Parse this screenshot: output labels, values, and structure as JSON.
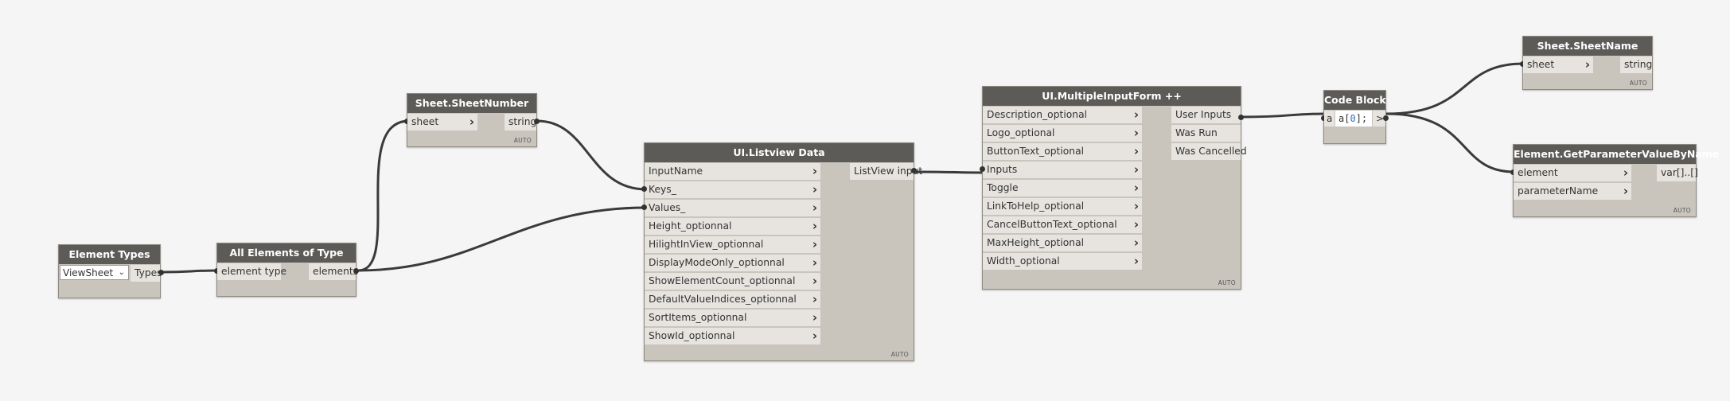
{
  "nodes": {
    "element_types": {
      "title": "Element Types",
      "dropdown_value": "ViewSheet",
      "output": "Types"
    },
    "all_elements": {
      "title": "All Elements of Type",
      "input": "element type",
      "output": "elements"
    },
    "sheet_number": {
      "title": "Sheet.SheetNumber",
      "input": "sheet",
      "output": "string",
      "badge": "AUTO"
    },
    "listview": {
      "title": "UI.Listview Data",
      "inputs": [
        "InputName",
        "Keys_",
        "Values_",
        "Height_optionnal",
        "HilightInView_optionnal",
        "DisplayModeOnly_optionnal",
        "ShowElementCount_optionnal",
        "DefaultValueIndices_optionnal",
        "SortItems_optionnal",
        "ShowId_optionnal"
      ],
      "output": "ListView input",
      "badge": "AUTO"
    },
    "multiform": {
      "title": "UI.MultipleInputForm ++",
      "inputs": [
        "Description_optional",
        "Logo_optional",
        "ButtonText_optional",
        "Inputs",
        "Toggle",
        "LinkToHelp_optional",
        "CancelButtonText_optional",
        "MaxHeight_optional",
        "Width_optional"
      ],
      "outputs": [
        "User Inputs",
        "Was Run",
        "Was Cancelled"
      ],
      "badge": "AUTO"
    },
    "code_block": {
      "title": "Code Block",
      "input": "a",
      "code_var": "a[",
      "code_index": "0",
      "code_end": "];",
      "output": ">"
    },
    "sheet_name": {
      "title": "Sheet.SheetName",
      "input": "sheet",
      "output": "string",
      "badge": "AUTO"
    },
    "get_param": {
      "title": "Element.GetParameterValueByName",
      "inputs": [
        "element",
        "parameterName"
      ],
      "output": "var[]..[]",
      "badge": "AUTO"
    }
  },
  "connections": [
    "Element Types.Types -> All Elements of Type.element type",
    "All Elements of Type.elements -> Sheet.SheetNumber.sheet",
    "All Elements of Type.elements -> UI.Listview Data.Values_",
    "Sheet.SheetNumber.string -> UI.Listview Data.Keys_",
    "UI.Listview Data.ListView input -> UI.MultipleInputForm ++.Inputs",
    "UI.MultipleInputForm ++.User Inputs -> Code Block.a",
    "Code Block.> -> Sheet.SheetName.sheet",
    "Code Block.> -> Element.GetParameterValueByName.element"
  ]
}
